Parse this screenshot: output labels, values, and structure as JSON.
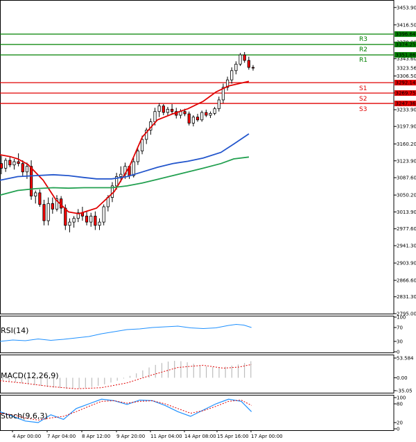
{
  "chart_data": {
    "type": "candlestick",
    "price_range": [
      2795,
      3470
    ],
    "price_ticks": [
      "3453.90",
      "3416.50",
      "3379.00",
      "3343.60",
      "3306.50",
      "3270.05",
      "3233.90",
      "3197.90",
      "3160.20",
      "3123.90",
      "3087.60",
      "3050.20",
      "3013.90",
      "2977.60",
      "2941.30",
      "2903.90",
      "2866.60",
      "2831.30",
      "2795.00"
    ],
    "x_labels": [
      "4 Apr 00:00",
      "7 Apr 04:00",
      "8 Apr 12:00",
      "9 Apr 20:00",
      "11 Apr 04:00",
      "14 Apr 08:00",
      "15 Apr 16:00",
      "17 Apr 00:00"
    ],
    "current_price": "3323.56",
    "levels": [
      {
        "name": "R3",
        "value": 3396.64,
        "label": "3396.64",
        "color": "#008000"
      },
      {
        "name": "R2",
        "value": 3374.25,
        "label": "3374.25",
        "color": "#008000"
      },
      {
        "name": "R1",
        "value": 3351.86,
        "label": "3351.86",
        "color": "#008000"
      },
      {
        "name": "S1",
        "value": 3292.14,
        "label": "3292.14",
        "color": "#e00000"
      },
      {
        "name": "S2",
        "value": 3269.75,
        "label": "3269.75",
        "color": "#e00000"
      },
      {
        "name": "S3",
        "value": 3247.36,
        "label": "3247.36",
        "color": "#e00000"
      }
    ],
    "candles": [
      [
        3118,
        3135,
        3095,
        3108
      ],
      [
        3108,
        3130,
        3100,
        3125
      ],
      [
        3125,
        3132,
        3110,
        3115
      ],
      [
        3115,
        3128,
        3105,
        3122
      ],
      [
        3122,
        3140,
        3112,
        3118
      ],
      [
        3118,
        3125,
        3090,
        3100
      ],
      [
        3100,
        3120,
        3085,
        3112
      ],
      [
        3112,
        3125,
        3040,
        3048
      ],
      [
        3048,
        3060,
        3032,
        3055
      ],
      [
        3055,
        3062,
        3025,
        3030
      ],
      [
        3030,
        3040,
        2985,
        2995
      ],
      [
        2995,
        3045,
        2985,
        3032
      ],
      [
        3032,
        3045,
        3010,
        3020
      ],
      [
        3020,
        3050,
        3015,
        3042
      ],
      [
        3042,
        3048,
        3010,
        3022
      ],
      [
        3022,
        3030,
        2975,
        2985
      ],
      [
        2985,
        3000,
        2970,
        2992
      ],
      [
        2992,
        3005,
        2980,
        3000
      ],
      [
        3000,
        3020,
        2992,
        3012
      ],
      [
        3012,
        3025,
        2995,
        3005
      ],
      [
        3005,
        3015,
        2985,
        2992
      ],
      [
        2992,
        3012,
        2982,
        3005
      ],
      [
        3005,
        3015,
        2975,
        2985
      ],
      [
        2985,
        3000,
        2975,
        2992
      ],
      [
        2992,
        3030,
        2985,
        3025
      ],
      [
        3025,
        3050,
        3015,
        3045
      ],
      [
        3045,
        3078,
        3035,
        3070
      ],
      [
        3070,
        3098,
        3062,
        3090
      ],
      [
        3090,
        3112,
        3078,
        3095
      ],
      [
        3095,
        3120,
        3085,
        3112
      ],
      [
        3112,
        3108,
        3085,
        3092
      ],
      [
        3092,
        3130,
        3088,
        3122
      ],
      [
        3122,
        3150,
        3115,
        3145
      ],
      [
        3145,
        3178,
        3138,
        3170
      ],
      [
        3170,
        3195,
        3160,
        3190
      ],
      [
        3190,
        3215,
        3180,
        3208
      ],
      [
        3208,
        3238,
        3200,
        3230
      ],
      [
        3230,
        3248,
        3218,
        3242
      ],
      [
        3242,
        3246,
        3222,
        3228
      ],
      [
        3228,
        3240,
        3220,
        3235
      ],
      [
        3235,
        3246,
        3225,
        3230
      ],
      [
        3230,
        3238,
        3215,
        3222
      ],
      [
        3222,
        3235,
        3215,
        3230
      ],
      [
        3230,
        3236,
        3220,
        3225
      ],
      [
        3225,
        3230,
        3200,
        3205
      ],
      [
        3205,
        3222,
        3198,
        3218
      ],
      [
        3218,
        3225,
        3208,
        3212
      ],
      [
        3212,
        3232,
        3208,
        3228
      ],
      [
        3228,
        3234,
        3218,
        3222
      ],
      [
        3222,
        3230,
        3216,
        3226
      ],
      [
        3226,
        3240,
        3222,
        3236
      ],
      [
        3236,
        3262,
        3230,
        3255
      ],
      [
        3255,
        3290,
        3248,
        3282
      ],
      [
        3282,
        3305,
        3275,
        3298
      ],
      [
        3298,
        3325,
        3290,
        3318
      ],
      [
        3318,
        3338,
        3310,
        3332
      ],
      [
        3332,
        3356,
        3328,
        3352
      ],
      [
        3352,
        3358,
        3335,
        3340
      ],
      [
        3340,
        3348,
        3320,
        3325
      ],
      [
        3325,
        3330,
        3318,
        3323.56
      ]
    ],
    "ma_red": [
      [
        0,
        3137
      ],
      [
        0.04,
        3133
      ],
      [
        0.07,
        3128
      ],
      [
        0.11,
        3116
      ],
      [
        0.17,
        3082
      ],
      [
        0.22,
        3040
      ],
      [
        0.27,
        3014
      ],
      [
        0.31,
        3010
      ],
      [
        0.38,
        3022
      ],
      [
        0.45,
        3058
      ],
      [
        0.51,
        3112
      ],
      [
        0.56,
        3175
      ],
      [
        0.62,
        3212
      ],
      [
        0.68,
        3225
      ],
      [
        0.74,
        3236
      ],
      [
        0.8,
        3252
      ],
      [
        0.85,
        3272
      ],
      [
        0.9,
        3285
      ],
      [
        0.98,
        3295
      ]
    ],
    "ma_blue": [
      [
        0,
        3082
      ],
      [
        0.07,
        3090
      ],
      [
        0.14,
        3092
      ],
      [
        0.21,
        3094
      ],
      [
        0.27,
        3092
      ],
      [
        0.33,
        3088
      ],
      [
        0.38,
        3085
      ],
      [
        0.44,
        3085
      ],
      [
        0.5,
        3090
      ],
      [
        0.56,
        3100
      ],
      [
        0.62,
        3110
      ],
      [
        0.68,
        3118
      ],
      [
        0.74,
        3123
      ],
      [
        0.8,
        3130
      ],
      [
        0.87,
        3142
      ],
      [
        0.92,
        3160
      ],
      [
        0.98,
        3182
      ]
    ],
    "ma_green": [
      [
        0,
        3050
      ],
      [
        0.07,
        3060
      ],
      [
        0.14,
        3064
      ],
      [
        0.21,
        3066
      ],
      [
        0.27,
        3065
      ],
      [
        0.33,
        3066
      ],
      [
        0.38,
        3066
      ],
      [
        0.44,
        3066
      ],
      [
        0.5,
        3070
      ],
      [
        0.56,
        3076
      ],
      [
        0.62,
        3084
      ],
      [
        0.68,
        3092
      ],
      [
        0.74,
        3100
      ],
      [
        0.8,
        3108
      ],
      [
        0.87,
        3118
      ],
      [
        0.92,
        3128
      ],
      [
        0.98,
        3132
      ]
    ],
    "indicators": {
      "rsi": {
        "label": "RSI(14)",
        "ticks": [
          "100",
          "70",
          "30",
          "0"
        ],
        "values": [
          [
            0,
            30
          ],
          [
            0.05,
            34
          ],
          [
            0.1,
            32
          ],
          [
            0.15,
            37
          ],
          [
            0.2,
            33
          ],
          [
            0.25,
            36
          ],
          [
            0.3,
            40
          ],
          [
            0.35,
            44
          ],
          [
            0.4,
            52
          ],
          [
            0.45,
            58
          ],
          [
            0.5,
            64
          ],
          [
            0.55,
            66
          ],
          [
            0.6,
            70
          ],
          [
            0.65,
            72
          ],
          [
            0.7,
            74
          ],
          [
            0.75,
            69
          ],
          [
            0.8,
            67
          ],
          [
            0.85,
            69
          ],
          [
            0.9,
            76
          ],
          [
            0.93,
            79
          ],
          [
            0.96,
            77
          ],
          [
            0.99,
            70
          ]
        ]
      },
      "macd": {
        "label": "MACD(12,26,9)",
        "ticks": [
          "53.584",
          "0.00",
          "-35.05"
        ],
        "range": [
          -35.05,
          53.584
        ],
        "hist": [
          -8,
          -10,
          -12,
          -15,
          -18,
          -20,
          -22,
          -25,
          -27,
          -28,
          -30,
          -30,
          -29,
          -27,
          -25,
          -22,
          -18,
          -13,
          -8,
          -2,
          5,
          12,
          20,
          28,
          35,
          40,
          44,
          46,
          45,
          42,
          38,
          34,
          31,
          29,
          28,
          30,
          33,
          36,
          40,
          45
        ],
        "signal": [
          [
            0,
            -8
          ],
          [
            0.1,
            -15
          ],
          [
            0.2,
            -24
          ],
          [
            0.3,
            -30
          ],
          [
            0.4,
            -27
          ],
          [
            0.5,
            -14
          ],
          [
            0.6,
            8
          ],
          [
            0.7,
            28
          ],
          [
            0.8,
            34
          ],
          [
            0.88,
            26
          ],
          [
            0.94,
            29
          ],
          [
            0.99,
            36
          ]
        ]
      },
      "stoch": {
        "label": "Stoch(9,6,3)",
        "ticks": [
          "100",
          "80",
          "20",
          "0"
        ],
        "k": [
          [
            0,
            55
          ],
          [
            0.05,
            40
          ],
          [
            0.1,
            25
          ],
          [
            0.15,
            20
          ],
          [
            0.2,
            45
          ],
          [
            0.25,
            30
          ],
          [
            0.3,
            65
          ],
          [
            0.35,
            80
          ],
          [
            0.4,
            95
          ],
          [
            0.45,
            90
          ],
          [
            0.5,
            78
          ],
          [
            0.55,
            92
          ],
          [
            0.6,
            90
          ],
          [
            0.65,
            75
          ],
          [
            0.7,
            55
          ],
          [
            0.75,
            40
          ],
          [
            0.8,
            60
          ],
          [
            0.85,
            80
          ],
          [
            0.9,
            95
          ],
          [
            0.95,
            88
          ],
          [
            0.99,
            55
          ]
        ],
        "d": [
          [
            0,
            50
          ],
          [
            0.05,
            45
          ],
          [
            0.1,
            35
          ],
          [
            0.15,
            28
          ],
          [
            0.2,
            35
          ],
          [
            0.25,
            40
          ],
          [
            0.3,
            55
          ],
          [
            0.35,
            72
          ],
          [
            0.4,
            88
          ],
          [
            0.45,
            90
          ],
          [
            0.5,
            82
          ],
          [
            0.55,
            88
          ],
          [
            0.6,
            90
          ],
          [
            0.65,
            80
          ],
          [
            0.7,
            65
          ],
          [
            0.75,
            50
          ],
          [
            0.8,
            58
          ],
          [
            0.85,
            72
          ],
          [
            0.9,
            88
          ],
          [
            0.95,
            92
          ],
          [
            0.99,
            75
          ]
        ]
      }
    }
  }
}
